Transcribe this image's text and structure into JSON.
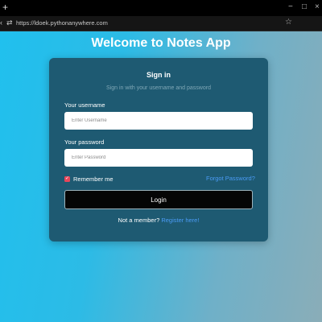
{
  "browser": {
    "url": "https://ldoek.pythonanywhere.com",
    "new_tab_icon": "plus-icon",
    "bookmark_icon": "star-icon"
  },
  "page": {
    "title": "Welcome to Notes App"
  },
  "card": {
    "title": "Sign in",
    "subtitle": "Sign in with your username and password",
    "username_label": "Your username",
    "username_placeholder": "Enter Username",
    "password_label": "Your password",
    "password_placeholder": "Enter Password",
    "remember_label": "Remember me",
    "remember_checked": true,
    "forgot_link": "Forgot Password?",
    "login_button": "Login",
    "member_text": "Not a member?",
    "register_link": "Register here!"
  },
  "colors": {
    "card_bg": "#1e5a72",
    "link": "#4a9bf5",
    "checkbox": "#e8465a",
    "button_bg": "#050505"
  }
}
